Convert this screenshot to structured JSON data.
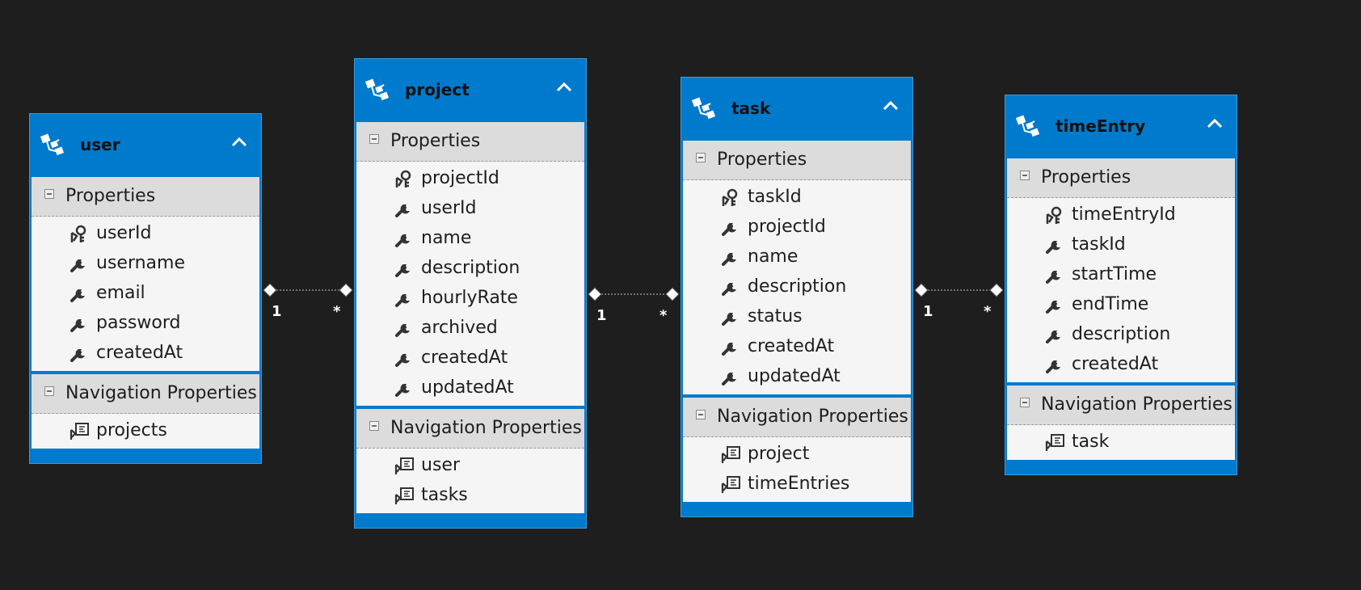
{
  "colors": {
    "canvas": "#1e1e1e",
    "entity_header": "#007acc",
    "section_header": "#dcdcdc",
    "row_bg": "#f5f5f5"
  },
  "entities": [
    {
      "title": "user",
      "properties_label": "Properties",
      "properties": [
        {
          "name": "userId",
          "icon": "key-icon"
        },
        {
          "name": "username",
          "icon": "wrench-icon"
        },
        {
          "name": "email",
          "icon": "wrench-icon"
        },
        {
          "name": "password",
          "icon": "wrench-icon"
        },
        {
          "name": "createdAt",
          "icon": "wrench-icon"
        }
      ],
      "navigation_label": "Navigation Properties",
      "navigation": [
        {
          "name": "projects",
          "icon": "navigation-property-icon"
        }
      ]
    },
    {
      "title": "project",
      "properties_label": "Properties",
      "properties": [
        {
          "name": "projectId",
          "icon": "key-icon"
        },
        {
          "name": "userId",
          "icon": "wrench-icon"
        },
        {
          "name": "name",
          "icon": "wrench-icon"
        },
        {
          "name": "description",
          "icon": "wrench-icon"
        },
        {
          "name": "hourlyRate",
          "icon": "wrench-icon"
        },
        {
          "name": "archived",
          "icon": "wrench-icon"
        },
        {
          "name": "createdAt",
          "icon": "wrench-icon"
        },
        {
          "name": "updatedAt",
          "icon": "wrench-icon"
        }
      ],
      "navigation_label": "Navigation Properties",
      "navigation": [
        {
          "name": "user",
          "icon": "navigation-property-icon"
        },
        {
          "name": "tasks",
          "icon": "navigation-property-icon"
        }
      ]
    },
    {
      "title": "task",
      "properties_label": "Properties",
      "properties": [
        {
          "name": "taskId",
          "icon": "key-icon"
        },
        {
          "name": "projectId",
          "icon": "wrench-icon"
        },
        {
          "name": "name",
          "icon": "wrench-icon"
        },
        {
          "name": "description",
          "icon": "wrench-icon"
        },
        {
          "name": "status",
          "icon": "wrench-icon"
        },
        {
          "name": "createdAt",
          "icon": "wrench-icon"
        },
        {
          "name": "updatedAt",
          "icon": "wrench-icon"
        }
      ],
      "navigation_label": "Navigation Properties",
      "navigation": [
        {
          "name": "project",
          "icon": "navigation-property-icon"
        },
        {
          "name": "timeEntries",
          "icon": "navigation-property-icon"
        }
      ]
    },
    {
      "title": "timeEntry",
      "properties_label": "Properties",
      "properties": [
        {
          "name": "timeEntryId",
          "icon": "key-icon"
        },
        {
          "name": "taskId",
          "icon": "wrench-icon"
        },
        {
          "name": "startTime",
          "icon": "wrench-icon"
        },
        {
          "name": "endTime",
          "icon": "wrench-icon"
        },
        {
          "name": "description",
          "icon": "wrench-icon"
        },
        {
          "name": "createdAt",
          "icon": "wrench-icon"
        }
      ],
      "navigation_label": "Navigation Properties",
      "navigation": [
        {
          "name": "task",
          "icon": "navigation-property-icon"
        }
      ]
    }
  ],
  "associations": [
    {
      "from": "user",
      "to": "project",
      "from_multiplicity": "1",
      "to_multiplicity": "*"
    },
    {
      "from": "project",
      "to": "task",
      "from_multiplicity": "1",
      "to_multiplicity": "*"
    },
    {
      "from": "task",
      "to": "timeEntry",
      "from_multiplicity": "1",
      "to_multiplicity": "*"
    }
  ]
}
